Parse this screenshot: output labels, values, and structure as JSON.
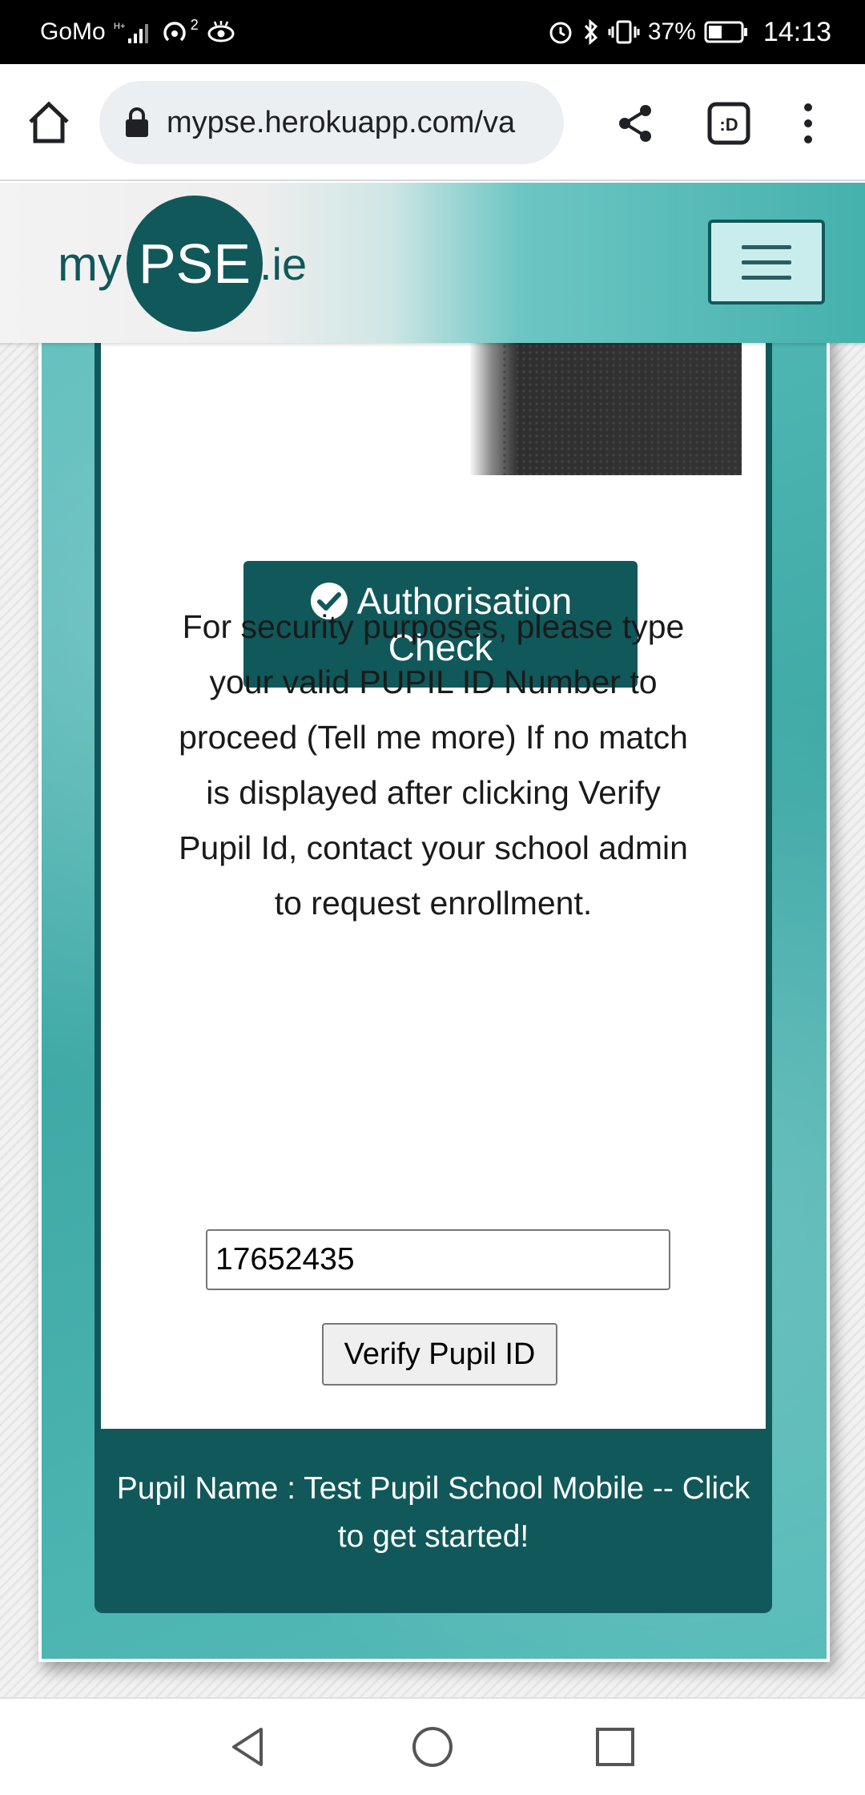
{
  "status_bar": {
    "carrier": "GoMo",
    "hotspot_count": "2",
    "battery": "37%",
    "time": "14:13",
    "icons": [
      "signal-icon",
      "hotspot-icon",
      "eye-icon",
      "alarm-icon",
      "bluetooth-icon",
      "vibrate-icon",
      "battery-icon"
    ]
  },
  "browser": {
    "url": "mypse.herokuapp.com/va",
    "tabs_label": ":D",
    "icons": [
      "home-icon",
      "lock-icon",
      "share-icon",
      "tabs-icon",
      "menu-icon"
    ]
  },
  "header": {
    "logo_my": "my",
    "logo_pse": "PSE",
    "logo_ie": ".ie",
    "menu_icon": "hamburger-icon"
  },
  "main": {
    "auth_button_line1": "Authorisation",
    "auth_button_line2": "Check",
    "description": "For security purposes, please type your valid PUPIL ID Number to proceed (Tell me more) If no match is displayed after clicking Verify Pupil Id, contact your school admin to request enrollment.",
    "pupil_id_value": "17652435",
    "verify_button": "Verify Pupil ID",
    "footer_text": "Pupil Name : Test Pupil School Mobile -- Click to get started!"
  },
  "colors": {
    "brand_dark": "#11585a",
    "brand_teal": "#45b1ad"
  }
}
